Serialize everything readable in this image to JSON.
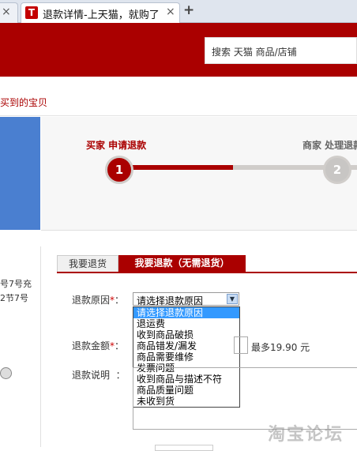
{
  "browser": {
    "tabs": [
      {
        "title": "退款详情-上天猫，就购了",
        "favicon": "T"
      }
    ],
    "close_glyph": "×",
    "new_tab_glyph": "+"
  },
  "header": {
    "search_placeholder": "搜索 天猫 商品/店铺",
    "brand_color": "#aa0000"
  },
  "breadcrumb": "买到的宝贝",
  "progress": {
    "steps": [
      {
        "number": "1",
        "label": "买家 申请退款",
        "active": true
      },
      {
        "number": "2",
        "label": "商家 处理退款",
        "active": false
      }
    ]
  },
  "sidebar": {
    "lines": [
      "号7号充",
      "2节7号"
    ]
  },
  "tabs": [
    {
      "label": "我要退货",
      "selected": false
    },
    {
      "label": "我要退款（无需退货）",
      "selected": true
    }
  ],
  "form": {
    "reason_label": "退款原因",
    "required_mark": "*",
    "colon": "：",
    "reason_selected": "请选择退款原因",
    "reason_options": [
      "请选择退款原因",
      "退运费",
      "收到商品破损",
      "商品错发/漏发",
      "商品需要维修",
      "发票问题",
      "收到商品与描述不符",
      "商品质量问题",
      "未收到货"
    ],
    "amount_label": "退款金额",
    "max_amount": "最多19.90 元",
    "description_label": "退款说明"
  },
  "watermark": "淘宝论坛"
}
